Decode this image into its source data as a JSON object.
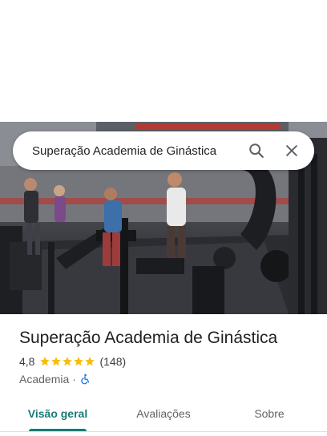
{
  "search": {
    "query": "Superação Academia de Ginástica",
    "search_icon": "search-icon",
    "close_icon": "close-icon"
  },
  "photo": {
    "subject": "gym-interior"
  },
  "place": {
    "title": "Superação Academia de Ginástica",
    "rating": "4,8",
    "rating_value": 4.8,
    "stars_max": 5,
    "review_count": "(148)",
    "category": "Academia",
    "separator": "·",
    "accessibility_icon": "wheelchair-icon"
  },
  "tabs": [
    {
      "label": "Visão geral",
      "active": true
    },
    {
      "label": "Avaliações",
      "active": false
    },
    {
      "label": "Sobre",
      "active": false
    }
  ],
  "colors": {
    "accent": "#1a7a76",
    "star": "#fbbc04",
    "accessibility": "#1a73e8",
    "text_primary": "#202124",
    "text_secondary": "#5f6368"
  }
}
